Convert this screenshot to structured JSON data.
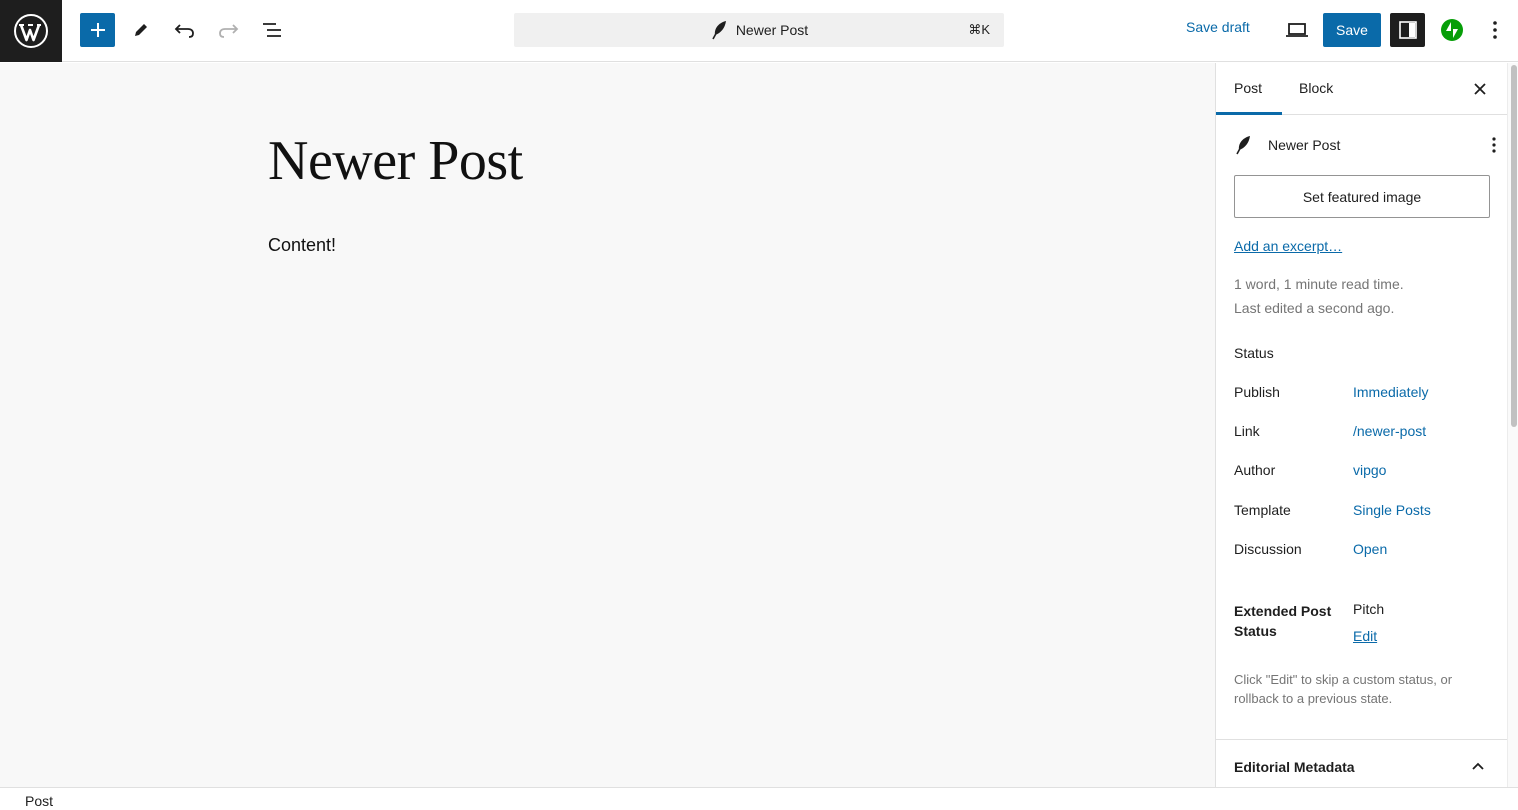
{
  "toolbar": {
    "add_block_icon": "plus-icon",
    "tools_icon": "pencil-icon",
    "undo_icon": "undo-icon",
    "redo_icon": "redo-icon",
    "outline_icon": "list-view-icon",
    "command_title": "Newer Post",
    "command_shortcut": "⌘K",
    "save_draft_label": "Save draft",
    "save_label": "Save",
    "accent_color": "#0a6aa9"
  },
  "editor": {
    "title": "Newer Post",
    "content": "Content!"
  },
  "sidebar": {
    "tabs": [
      {
        "label": "Post",
        "active": true
      },
      {
        "label": "Block",
        "active": false
      }
    ],
    "post_name": "Newer Post",
    "featured_image_label": "Set featured image",
    "excerpt_link": "Add an excerpt…",
    "word_count": "1 word, 1 minute read time.",
    "last_edited": "Last edited a second ago.",
    "status_label": "Status",
    "rows": [
      {
        "label": "Publish",
        "value": "Immediately"
      },
      {
        "label": "Link",
        "value": "/newer-post"
      },
      {
        "label": "Author",
        "value": "vipgo"
      },
      {
        "label": "Template",
        "value": "Single Posts"
      },
      {
        "label": "Discussion",
        "value": "Open"
      }
    ],
    "extended_status": {
      "label": "Extended Post Status",
      "value": "Pitch",
      "edit_label": "Edit",
      "note": "Click \"Edit\" to skip a custom status, or rollback to a previous state."
    },
    "editorial_metadata_label": "Editorial Metadata"
  },
  "footer": {
    "breadcrumb": "Post"
  }
}
